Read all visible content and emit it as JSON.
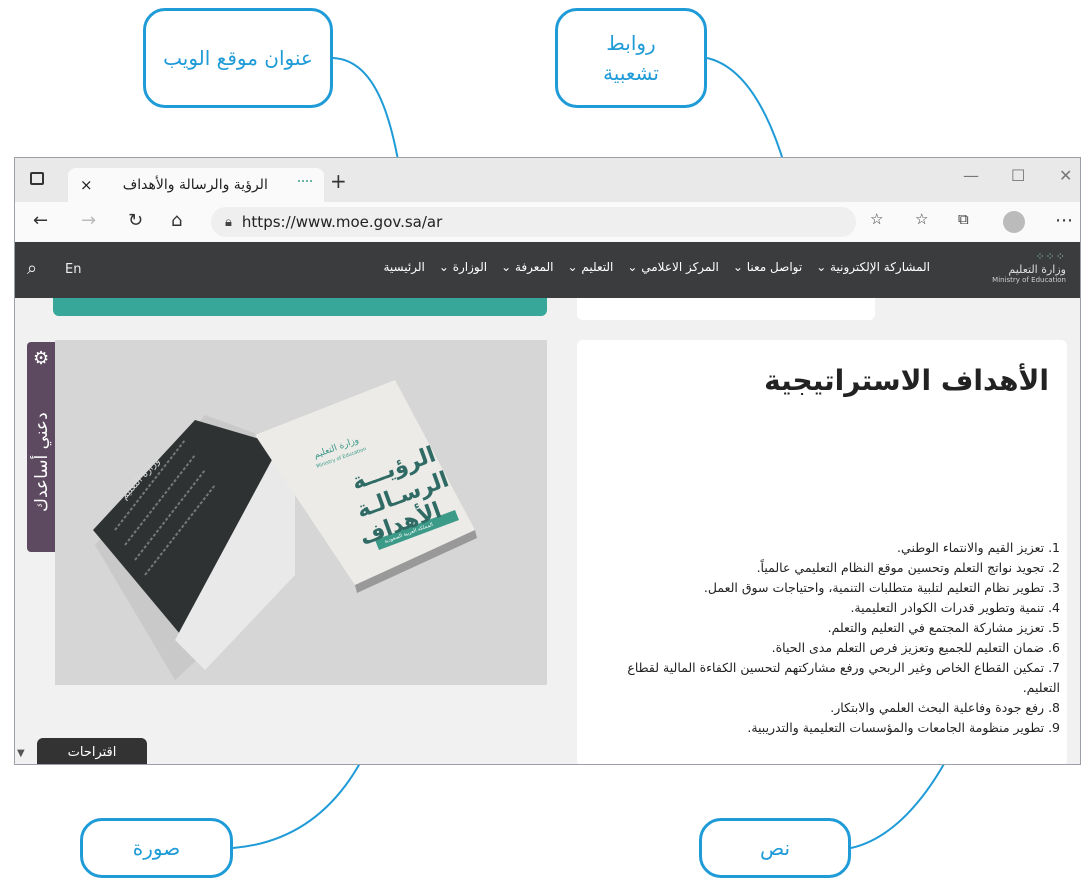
{
  "callouts": {
    "web_title": "عنوان موقع الويب",
    "links": "روابط تشعبية",
    "image": "صورة",
    "text": "نص"
  },
  "browser": {
    "tab_title": "الرؤية والرسالة والأهداف",
    "url": "https://www.moe.gov.sa/ar",
    "new_tab": "+",
    "close": "×"
  },
  "site": {
    "lang": "En",
    "logo": "وزارة التعليم",
    "logo_sub": "Ministry of Education",
    "nav": [
      "الرئيسية",
      "الوزارة ⌄",
      "المعرفة ⌄",
      "التعليم ⌄",
      "المركز الاعلامي ⌄",
      "تواصل معنا ⌄",
      "المشاركة الإلكترونية ⌄"
    ],
    "help_label": "دعني أساعدك",
    "suggestions_label": "اقتراحات",
    "heading": "الأهداف الاستراتيجية",
    "goals": [
      "1. تعزيز القيم والانتماء الوطني.",
      "2. تجويد نواتج التعلم وتحسين موقع النظام التعليمي عالمياً.",
      "3. تطوير نظام التعليم لتلبية متطلبات التنمية، واحتياجات سوق العمل.",
      "4. تنمية وتطوير قدرات الكوادر التعليمية.",
      "5. تعزيز مشاركة المجتمع في التعليم والتعلم.",
      "6. ضمان التعليم للجميع وتعزيز فرص التعلم مدى الحياة.",
      "7. تمكين القطاع الخاص وغير الربحي ورفع مشاركتهم لتحسين الكفاءة المالية لقطاع التعليم.",
      "8. رفع جودة وفاعلية البحث العلمي والابتكار.",
      "9. تطوير منظومة الجامعات والمؤسسات التعليمية والتدريبية."
    ],
    "book": {
      "spine_title": "وزارة التعليم",
      "cover_title_1": "الرؤيـــة",
      "cover_title_2": "الرسـالـة",
      "cover_title_3": "الأهداف",
      "cover_logo": "وزارة التعليم",
      "cover_sub": "Ministry of Education",
      "cover_band": "المملكة العربية السعودية"
    }
  },
  "colors": {
    "accent": "#1f9bd7",
    "nav_bg": "#3b3c3e",
    "teal": "#36a798",
    "help_tab": "#5e4a60"
  }
}
